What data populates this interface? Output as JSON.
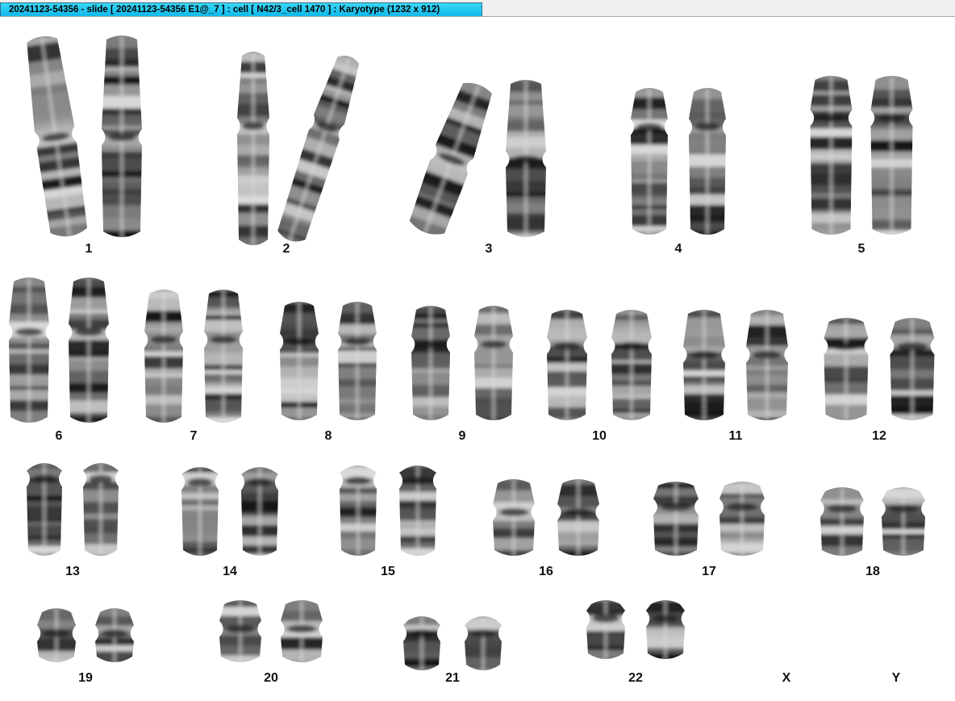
{
  "window": {
    "title": "20241123-54356 - slide [ 20241123-54356 E1@_7 ] : cell [ N42/3_cell 1470 ] : Karyotype  (1232 x 912)"
  },
  "karyotype": {
    "labels": {
      "c1": "1",
      "c2": "2",
      "c3": "3",
      "c4": "4",
      "c5": "5",
      "c6": "6",
      "c7": "7",
      "c8": "8",
      "c9": "9",
      "c10": "10",
      "c11": "11",
      "c12": "12",
      "c13": "13",
      "c14": "14",
      "c15": "15",
      "c16": "16",
      "c17": "17",
      "c18": "18",
      "c19": "19",
      "c20": "20",
      "c21": "21",
      "c22": "22",
      "cX": "X",
      "cY": "Y"
    },
    "copies": {
      "c1": 2,
      "c2": 2,
      "c3": 2,
      "c4": 2,
      "c5": 2,
      "c6": 2,
      "c7": 2,
      "c8": 2,
      "c9": 2,
      "c10": 2,
      "c11": 2,
      "c12": 2,
      "c13": 2,
      "c14": 2,
      "c15": 2,
      "c16": 2,
      "c17": 2,
      "c18": 2,
      "c19": 2,
      "c20": 2,
      "c21": 2,
      "c22": 2,
      "cX": 0,
      "cY": 0
    }
  }
}
